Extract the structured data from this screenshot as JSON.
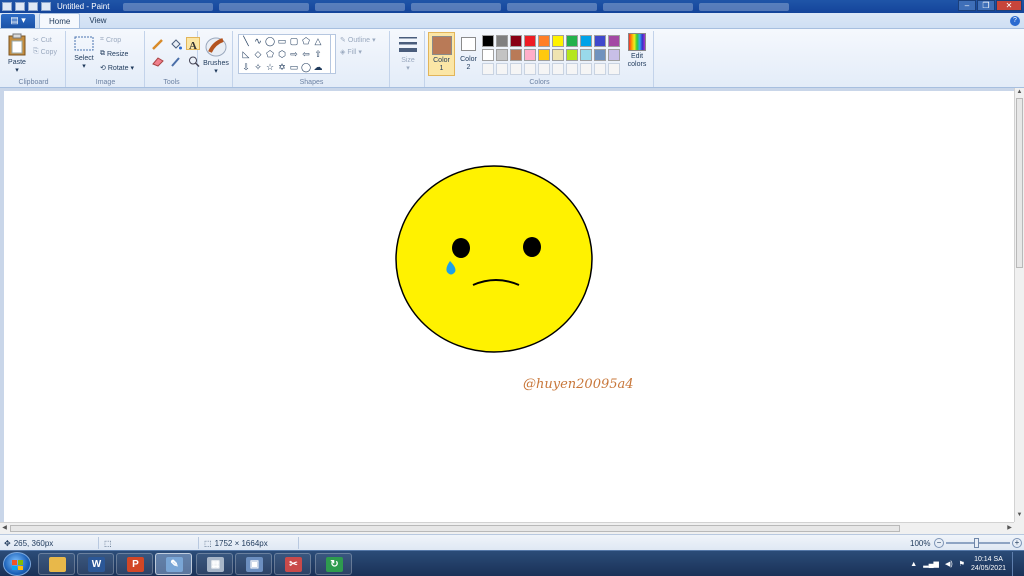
{
  "window": {
    "title": "Untitled - Paint",
    "controls": [
      "minimize",
      "restore",
      "close"
    ]
  },
  "tabs": [
    {
      "label": "Home",
      "active": true
    },
    {
      "label": "View",
      "active": false
    }
  ],
  "ribbon": {
    "clipboard": {
      "group": "Clipboard",
      "paste": "Paste",
      "cut": "Cut",
      "copy": "Copy"
    },
    "image": {
      "group": "Image",
      "select": "Select",
      "crop": "Crop",
      "resize": "Resize",
      "rotate": "Rotate"
    },
    "tools": {
      "group": "Tools",
      "active_tool": "text-tool"
    },
    "brushes": {
      "label": "Brushes"
    },
    "shapes": {
      "group": "Shapes",
      "outline": "Outline",
      "fill": "Fill"
    },
    "size": {
      "label": "Size"
    },
    "colors": {
      "group": "Colors",
      "color1_label": "Color\n1",
      "color2_label": "Color\n2",
      "color1": "#b97a57",
      "color2": "#ffffff",
      "edit_colors": "Edit\ncolors",
      "palette_row1": [
        "#000000",
        "#7f7f7f",
        "#880015",
        "#ed1c24",
        "#ff7f27",
        "#fff200",
        "#22b14c",
        "#00a2e8",
        "#3f48cc",
        "#a349a4"
      ],
      "palette_row2": [
        "#ffffff",
        "#c3c3c3",
        "#b97a57",
        "#ffaec9",
        "#ffc90e",
        "#efe4b0",
        "#b5e61d",
        "#99d9ea",
        "#7092be",
        "#c8bfe7"
      ]
    }
  },
  "canvas": {
    "face_color": "#fff200",
    "tear_color": "#1ea0e6",
    "signature": "@huyen20095a4",
    "signature_color": "#c8773a"
  },
  "status": {
    "cursor_position": "265, 360px",
    "image_size": "1752 × 1664px",
    "zoom": "100%"
  },
  "taskbar": {
    "apps": [
      "explorer",
      "word",
      "powerpoint",
      "paint",
      "calculator",
      "network",
      "snipping-tool",
      "excel-green"
    ],
    "time": "10:14 SA",
    "date": "24/05/2021"
  }
}
